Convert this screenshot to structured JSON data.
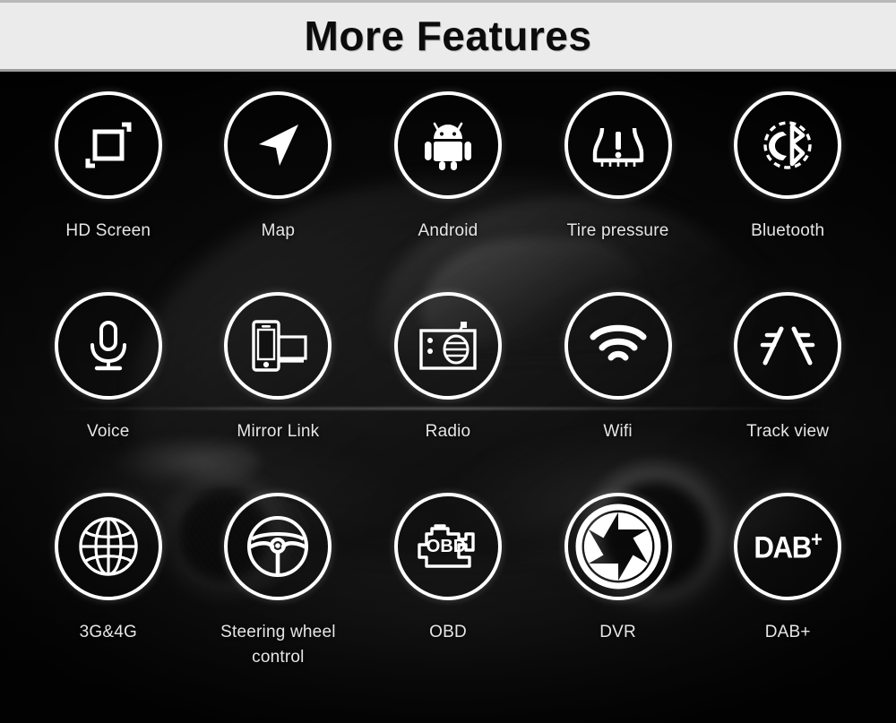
{
  "header": {
    "title": "More Features",
    "bar_color": "#ebebeb",
    "title_color": "#0c0c0c"
  },
  "theme": {
    "background": "#050505",
    "icon_color": "#ffffff",
    "label_color": "#e6e6e6"
  },
  "background_scene": "black sports car photograph",
  "features": [
    {
      "label": "HD Screen",
      "icon": "hd-screen-icon"
    },
    {
      "label": "Map",
      "icon": "navigation-arrow-icon"
    },
    {
      "label": "Android",
      "icon": "android-robot-icon"
    },
    {
      "label": "Tire pressure",
      "icon": "tire-pressure-warning-icon"
    },
    {
      "label": "Bluetooth",
      "icon": "bluetooth-phone-icon"
    },
    {
      "label": "Voice",
      "icon": "microphone-icon"
    },
    {
      "label": "Mirror Link",
      "icon": "phone-screen-mirror-icon"
    },
    {
      "label": "Radio",
      "icon": "radio-icon"
    },
    {
      "label": "Wifi",
      "icon": "wifi-icon"
    },
    {
      "label": "Track view",
      "icon": "parking-guideline-icon"
    },
    {
      "label": "3G&4G",
      "icon": "globe-icon"
    },
    {
      "label": "Steering wheel control",
      "icon": "steering-wheel-icon"
    },
    {
      "label": "OBD",
      "icon": "engine-obd-icon",
      "icon_text": "OBD"
    },
    {
      "label": "DVR",
      "icon": "camera-aperture-icon"
    },
    {
      "label": "DAB+",
      "icon": "dab-plus-logo-icon",
      "icon_text": "DAB",
      "icon_text_sup": "+"
    }
  ]
}
